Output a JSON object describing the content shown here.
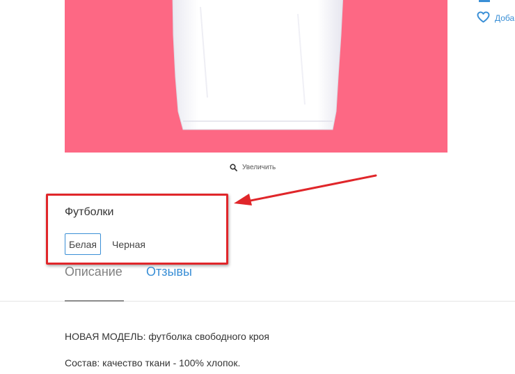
{
  "product": {
    "zoom_label": "Увеличить",
    "image_background": "#fd6884"
  },
  "sidebar": {
    "wishlist_label": "Доба"
  },
  "variants": {
    "title": "Футболки",
    "options": [
      {
        "label": "Белая",
        "selected": true
      },
      {
        "label": "Черная",
        "selected": false
      }
    ]
  },
  "tabs": [
    {
      "label": "Описание",
      "active": true
    },
    {
      "label": "Отзывы",
      "active": false
    }
  ],
  "description": {
    "lines": [
      "НОВАЯ МОДЕЛЬ: футболка свободного кроя",
      "Состав: качество ткани - 100% хлопок."
    ]
  },
  "colors": {
    "accent": "#3a8fd6",
    "annotation": "#e0262a"
  },
  "icons": {
    "zoom": "magnifier-icon",
    "wishlist": "heart-icon"
  }
}
